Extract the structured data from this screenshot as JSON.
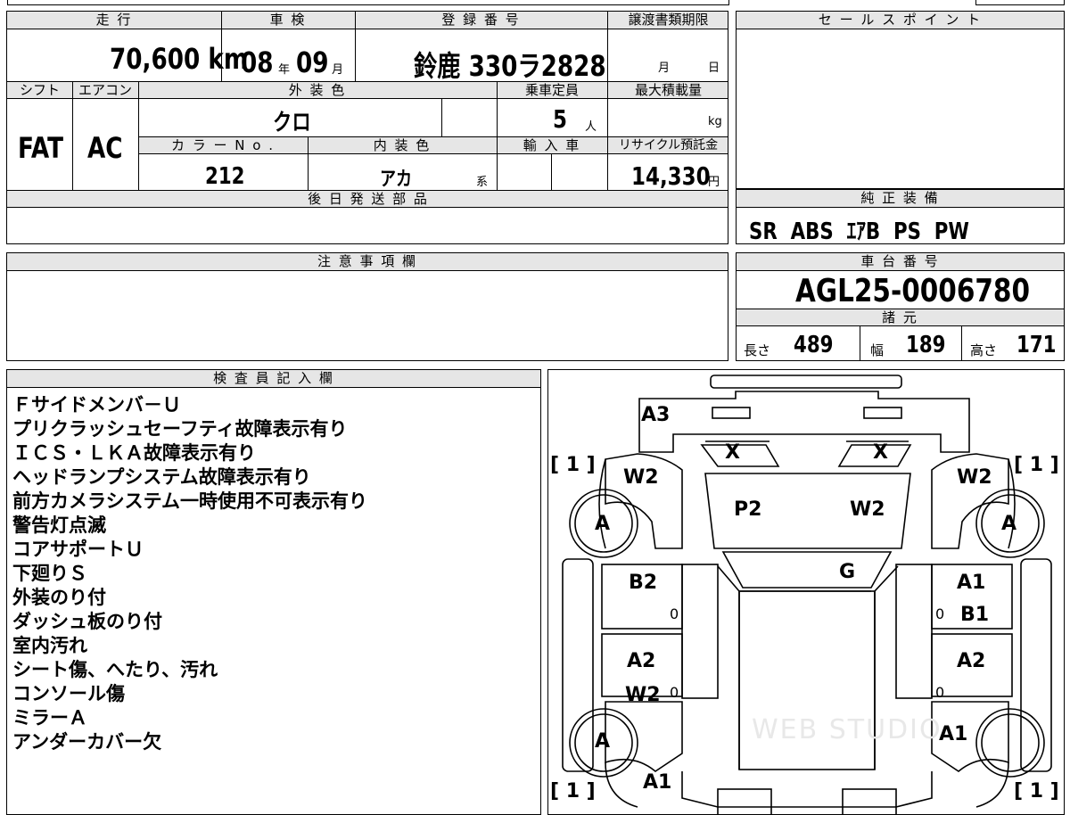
{
  "top_table": {
    "headers": {
      "mileage": "走 行",
      "inspection": "車 検",
      "registration": "登 録 番 号",
      "transfer_deadline": "譲渡書類期限",
      "shift": "シフト",
      "aircon": "エアコン",
      "exterior_color": "外 装 色",
      "capacity": "乗車定員",
      "max_load": "最大積載量",
      "color_no": "カ ラ ー N o .",
      "interior_color": "内 装 色",
      "import": "輸 入 車",
      "recycle": "リサイクル預託金",
      "parts_later": "後 日 発 送 部 品"
    },
    "mileage_value": "70,600 km",
    "inspection_year": "08",
    "inspection_year_unit": "年",
    "inspection_month": "09",
    "inspection_month_unit": "月",
    "registration_value": "鈴鹿 330ラ2828",
    "transfer_month_unit": "月",
    "transfer_day_unit": "日",
    "shift_value": "FAT",
    "aircon_value": "AC",
    "exterior_color_value": "クロ",
    "capacity_value": "5",
    "capacity_unit": "人",
    "max_load_unit": "kg",
    "color_no_value": "212",
    "interior_color_value": "アカ",
    "interior_color_suffix": "系",
    "recycle_value": "14,330",
    "recycle_unit": "円"
  },
  "sale_points": {
    "header": "セ ー ル ス ポ イ ン ト"
  },
  "genuine_equipment": {
    "header": "純 正 装 備",
    "value": "SR  ABS  ｴｱB  PS  PW"
  },
  "notes": {
    "header": "注 意 事 項 欄"
  },
  "chassis": {
    "header": "車 台 番 号",
    "value": "AGL25-0006780"
  },
  "specs": {
    "header": "諸 元",
    "length_label": "長さ",
    "length_value": "489",
    "width_label": "幅",
    "width_value": "189",
    "height_label": "高さ",
    "height_value": "171"
  },
  "inspector": {
    "header": "検 査 員 記 入 欄",
    "lines": [
      "Ｆサイドメンバ－Ｕ",
      "プリクラッシュセーフティ故障表示有り",
      "ＩＣＳ・ＬＫＡ故障表示有り",
      "ヘッドランプシステム故障表示有り",
      "前方カメラシステム一時使用不可表示有り",
      "警告灯点滅",
      "コアサポートＵ",
      "下廻りＳ",
      "外装のり付",
      "ダッシュ板のり付",
      "室内汚れ",
      "シート傷、へたり、汚れ",
      "コンソール傷",
      "ミラーＡ",
      "アンダーカバー欠"
    ]
  },
  "diagram": {
    "labels": {
      "front_bumper": "A3",
      "headlight_left": "X",
      "headlight_right": "X",
      "fender_front_left": "W2",
      "fender_front_right": "W2",
      "hood_left": "P2",
      "hood_right": "W2",
      "wheel_fl": "A",
      "wheel_fr": "A",
      "windshield": "G",
      "front_door_left": "B2",
      "front_door_right_1": "A1",
      "front_door_right_2": "B1",
      "rear_door_left_1": "A2",
      "rear_door_left_2": "W2",
      "rear_door_right": "A2",
      "wheel_rl": "A",
      "rear_right": "A1",
      "rear_fender_left": "A1",
      "bracket_tl": "[ 1 ]",
      "bracket_tr": "[ 1 ]",
      "bracket_bl": "[ 1 ]",
      "bracket_br": "[ 1 ]",
      "zero": "0",
      "watermark": "WEB STUDIO"
    }
  }
}
